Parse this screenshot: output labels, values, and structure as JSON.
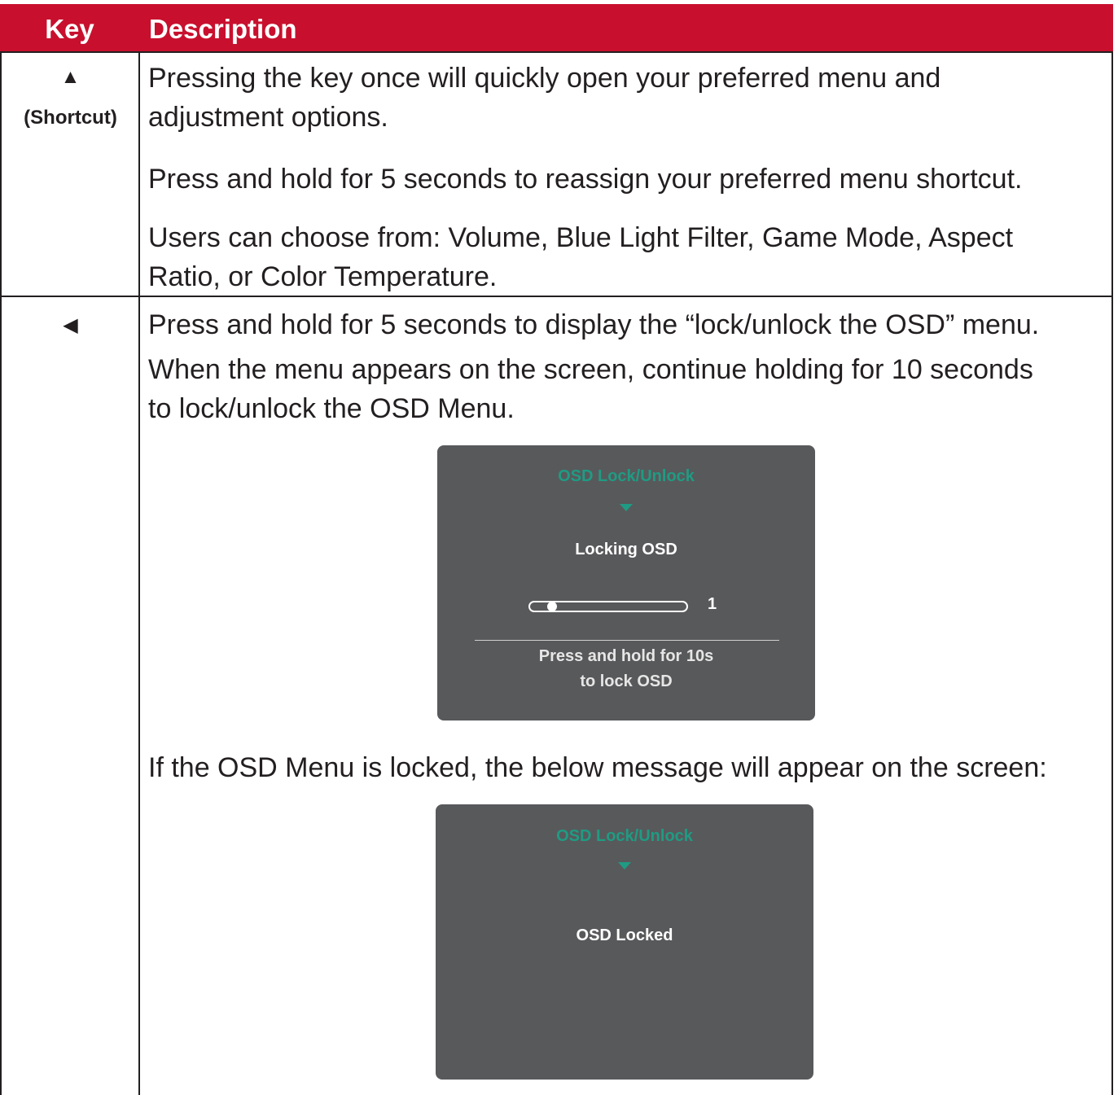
{
  "table": {
    "header": {
      "key": "Key",
      "description": "Description"
    },
    "rows": [
      {
        "key_icon": "up-arrow-icon",
        "key_symbol": "▲",
        "key_label": "(Shortcut)",
        "paragraphs": [
          "Pressing the key once will quickly open your preferred menu and",
          "adjustment options.",
          "Press and hold for 5 seconds to reassign your preferred menu shortcut.",
          "Users can choose from: Volume, Blue Light Filter, Game Mode, Aspect",
          "Ratio, or Color Temperature."
        ]
      },
      {
        "key_icon": "left-arrow-icon",
        "key_symbol": "◀",
        "paragraphs": [
          "Press and hold for 5 seconds to display the “lock/unlock the OSD” menu.",
          "When the menu appears on the screen, continue holding for 10 seconds",
          "to lock/unlock the OSD Menu.",
          "If the OSD Menu is locked, the below message will appear on the screen:"
        ],
        "osd_locking": {
          "title": "OSD Lock/Unlock",
          "status": "Locking OSD",
          "progress_value": "1",
          "progress_fraction": 0.05,
          "message_line1": "Press and hold for 10s",
          "message_line2": "to lock OSD"
        },
        "osd_locked": {
          "title": "OSD Lock/Unlock",
          "status": "OSD Locked"
        }
      }
    ]
  },
  "colors": {
    "header_bg": "#c8102e",
    "osd_bg": "#58595b",
    "osd_accent": "#1f9b83"
  }
}
